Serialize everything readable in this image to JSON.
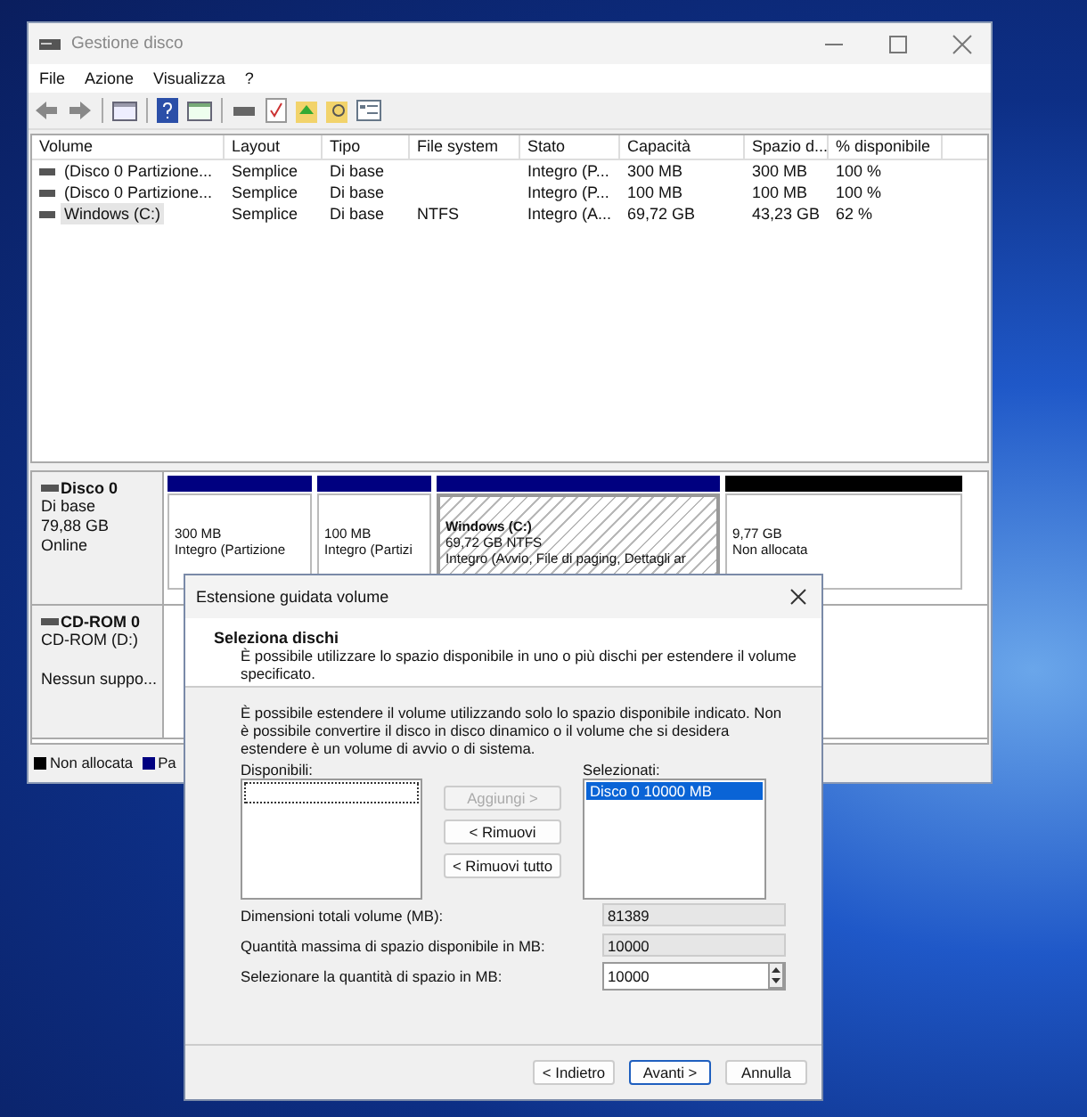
{
  "window": {
    "title": "Gestione disco"
  },
  "menu": [
    "File",
    "Azione",
    "Visualizza",
    "?"
  ],
  "table": {
    "columns": [
      "Volume",
      "Layout",
      "Tipo",
      "File system",
      "Stato",
      "Capacità",
      "Spazio d...",
      "% disponibile"
    ],
    "rows": [
      {
        "selected": false,
        "cells": [
          "(Disco 0 Partizione...",
          "Semplice",
          "Di base",
          "",
          "Integro (P...",
          "300 MB",
          "300 MB",
          "100 %"
        ]
      },
      {
        "selected": false,
        "cells": [
          "(Disco 0 Partizione...",
          "Semplice",
          "Di base",
          "",
          "Integro (P...",
          "100 MB",
          "100 MB",
          "100 %"
        ]
      },
      {
        "selected": true,
        "cells": [
          "Windows (C:)",
          "Semplice",
          "Di base",
          "NTFS",
          "Integro (A...",
          "69,72 GB",
          "43,23 GB",
          "62 %"
        ]
      }
    ]
  },
  "disks": [
    {
      "name": "Disco 0",
      "lines": [
        "Di base",
        "79,88 GB",
        "Online"
      ],
      "partitions": [
        {
          "lines": [
            "300 MB",
            "Integro (Partizione"
          ],
          "color": "#000080",
          "selected": false
        },
        {
          "lines": [
            "100 MB",
            "Integro (Partizi"
          ],
          "color": "#000080",
          "selected": false
        },
        {
          "title": "Windows  (C:)",
          "lines": [
            "69,72 GB NTFS",
            "Integro (Avvio, File di paging, Dettagli ar"
          ],
          "color": "#000080",
          "selected": true
        },
        {
          "lines": [
            "9,77 GB",
            "Non allocata"
          ],
          "color": "#000000",
          "selected": false
        }
      ]
    },
    {
      "name": "CD-ROM 0",
      "lines": [
        "CD-ROM (D:)",
        "Nessun suppo..."
      ]
    }
  ],
  "legend": [
    {
      "label": "Non allocata",
      "color": "#000000"
    },
    {
      "label": "Pa",
      "color": "#000080"
    }
  ],
  "dialog": {
    "title": "Estensione guidata volume",
    "heading": "Seleziona dischi",
    "subtitle": "È possibile utilizzare lo spazio disponibile in uno o più dischi per estendere il volume specificato.",
    "info": "È possibile estendere il volume utilizzando solo lo spazio disponibile indicato. Non è possibile convertire il disco in disco dinamico o il volume che si desidera estendere è un volume di avvio o di sistema.",
    "available_label": "Disponibili:",
    "selected_label": "Selezionati:",
    "selected_items": [
      {
        "label": "Disco 0     10000 MB",
        "selected": true
      }
    ],
    "move_buttons": [
      {
        "label": "Aggiungi >",
        "disabled": true
      },
      {
        "label": "< Rimuovi",
        "disabled": false
      },
      {
        "label": "< Rimuovi tutto",
        "disabled": false
      }
    ],
    "fields": [
      {
        "label": "Dimensioni totali volume (MB):",
        "value": "81389",
        "disabled": true,
        "kind": "text"
      },
      {
        "label": "Quantità massima di spazio disponibile in MB:",
        "value": "10000",
        "disabled": true,
        "kind": "text"
      },
      {
        "label": "Selezionare la quantità di spazio in MB:",
        "value": "10000",
        "disabled": false,
        "kind": "spinner"
      }
    ],
    "buttons": [
      {
        "label": "< Indietro",
        "default": false
      },
      {
        "label": "Avanti >",
        "default": true
      },
      {
        "label": "Annulla",
        "default": false
      }
    ]
  }
}
